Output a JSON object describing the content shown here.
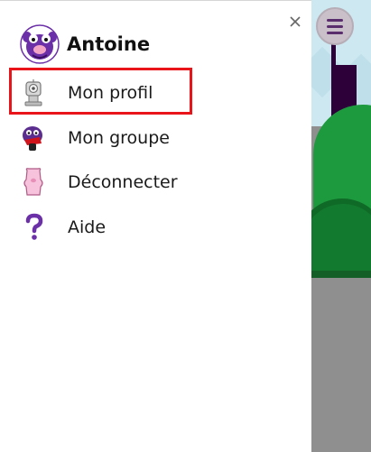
{
  "user": {
    "name": "Antoine",
    "avatar_icon": "purple-monster-avatar"
  },
  "close_icon": "close-icon",
  "menu": {
    "items": [
      {
        "label": "Mon profil",
        "icon": "profile-robot-icon"
      },
      {
        "label": "Mon groupe",
        "icon": "group-monster-icon"
      },
      {
        "label": "Déconnecter",
        "icon": "logout-pig-icon"
      },
      {
        "label": "Aide",
        "icon": "help-question-icon"
      }
    ]
  },
  "hamburger_icon": "hamburger-menu-icon",
  "colors": {
    "accent_purple": "#6b2fa8",
    "highlight_red": "#e8141a",
    "scene_green": "#1d9a3e",
    "scene_tower": "#2d003a"
  }
}
